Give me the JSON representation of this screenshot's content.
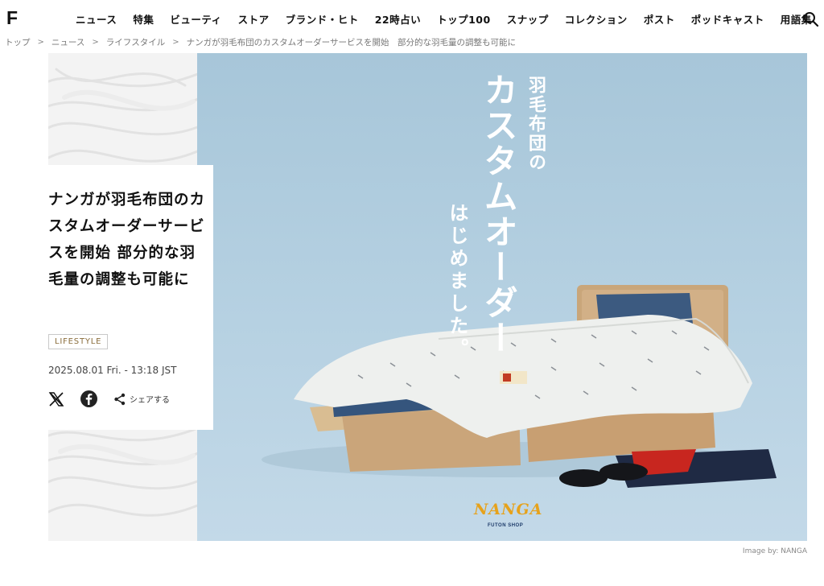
{
  "site": {
    "logo": "F"
  },
  "nav": {
    "items": [
      "ニュース",
      "特集",
      "ビューティ",
      "ストア",
      "ブランド・ヒト",
      "22時占い",
      "トップ100",
      "スナップ",
      "コレクション",
      "ポスト",
      "ポッドキャスト",
      "用語集"
    ],
    "search_icon": "search-icon"
  },
  "breadcrumb": {
    "items": [
      "トップ",
      "ニュース",
      "ライフスタイル"
    ],
    "current": "ナンガが羽毛布団のカスタムオーダーサービスを開始　部分的な羽毛量の調整も可能に",
    "separator": ">"
  },
  "article": {
    "title": "ナンガが羽毛布団のカスタムオーダーサービスを開始 部分的な羽毛量の調整も可能に",
    "category": "LIFESTYLE",
    "date": "2025.08.01 Fri. - 13:18 JST",
    "share_label": "シェアする",
    "image_credit": "Image by: NANGA"
  },
  "hero": {
    "catch_pre": "羽毛布団の",
    "catch_main": "カスタムオーダー",
    "catch_sub": "はじめました。",
    "brand_logo": "NANGA",
    "brand_sub": "FUTON SHOP"
  },
  "colors": {
    "accent_category": "#8a6d3b",
    "hero_bg": "#b6d1e2",
    "logo_orange": "#e6a21c"
  }
}
